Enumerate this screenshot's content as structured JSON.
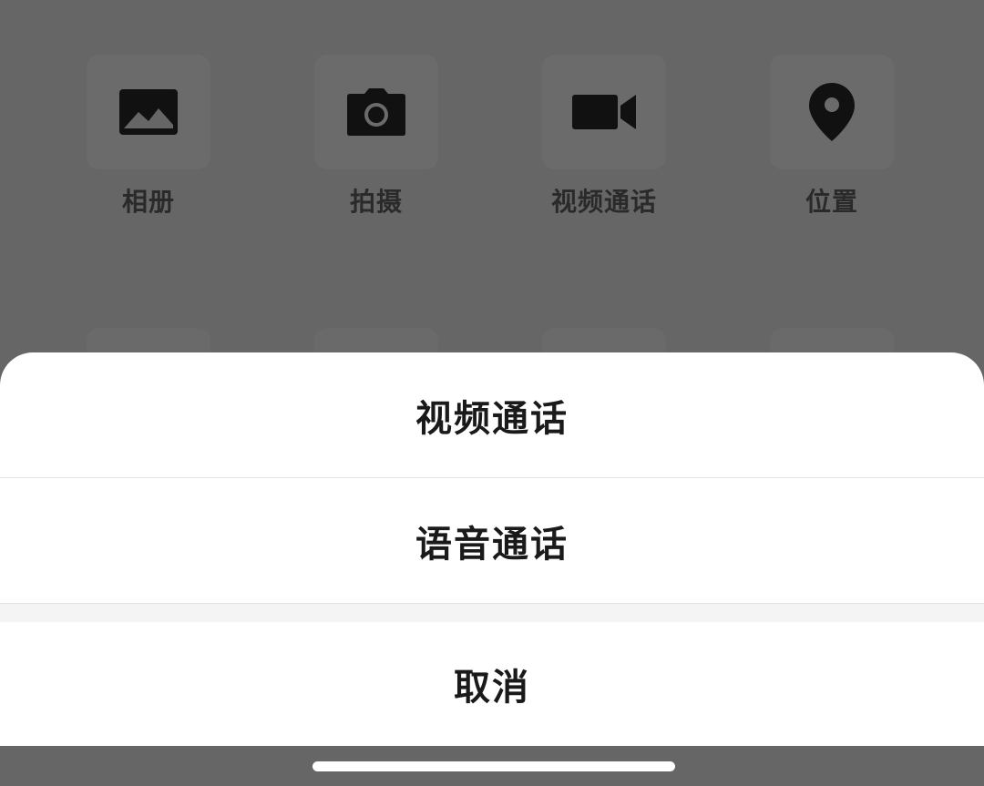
{
  "background_panel": {
    "items": [
      {
        "label": "相册",
        "icon": "photo-album-icon"
      },
      {
        "label": "拍摄",
        "icon": "camera-icon"
      },
      {
        "label": "视频通话",
        "icon": "video-camera-icon"
      },
      {
        "label": "位置",
        "icon": "location-pin-icon"
      }
    ]
  },
  "action_sheet": {
    "options": [
      {
        "label": "视频通话"
      },
      {
        "label": "语音通话"
      }
    ],
    "cancel_label": "取消"
  },
  "colors": {
    "overlay": "#666666",
    "sheet_background": "#ffffff",
    "text": "#1a1a1a",
    "divider": "#e2e2e2"
  }
}
